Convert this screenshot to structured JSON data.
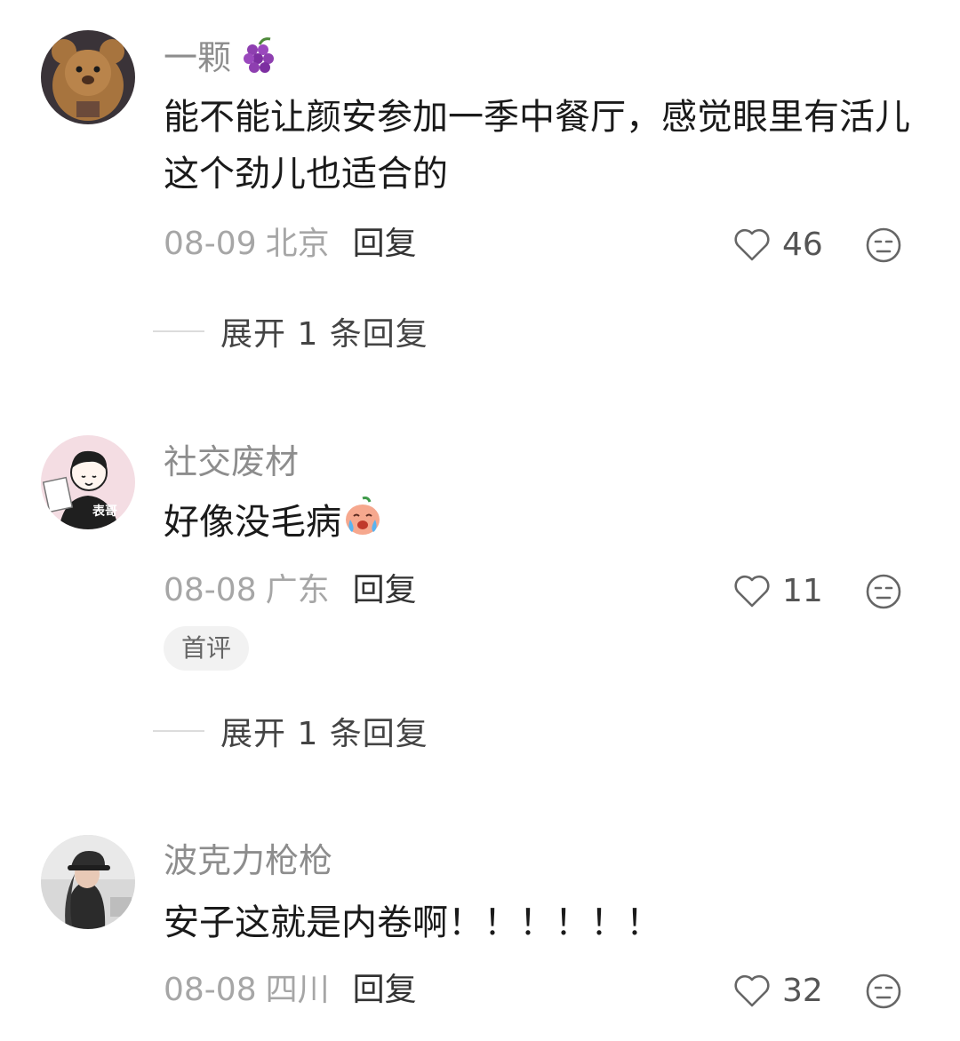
{
  "comments": [
    {
      "username": "一颗",
      "username_emoji": "grapes-emoji",
      "text": "能不能让颜安参加一季中餐厅，感觉眼里有活儿这个劲儿也适合的",
      "date": "08-09",
      "location": "北京",
      "reply_label": "回复",
      "likes": "46",
      "expand_label": "展开 1 条回复"
    },
    {
      "username": "社交废材",
      "text": "好像没毛病",
      "text_emoji": "crying-laughing-emoji",
      "date": "08-08",
      "location": "广东",
      "reply_label": "回复",
      "likes": "11",
      "badge": "首评",
      "expand_label": "展开 1 条回复",
      "avatar_text": "表哥"
    },
    {
      "username": "波克力枪枪",
      "text": "安子这就是内卷啊！！！！！！",
      "date": "08-08",
      "location": "四川",
      "reply_label": "回复",
      "likes": "32"
    }
  ],
  "colors": {
    "username": "#8d8d8d",
    "body_text": "#1a1a1a",
    "meta_text": "#a6a6a6",
    "reply_text": "#333333"
  }
}
